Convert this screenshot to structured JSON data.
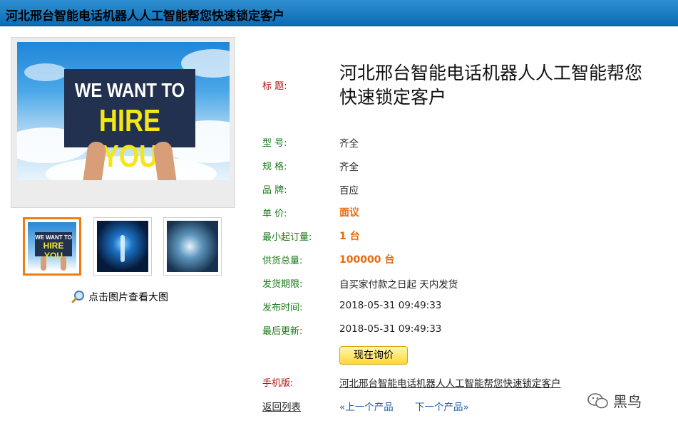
{
  "header": {
    "title": "河北邢台智能电话机器人人工智能帮您快速锁定客户"
  },
  "main_image": {
    "sign_line1": "WE WANT TO",
    "sign_line2": "HIRE YOU"
  },
  "thumbs": [
    {
      "line1": "WE WANT TO",
      "line2": "HIRE YOU"
    }
  ],
  "gallery": {
    "enlarge_label": "点击图片查看大图"
  },
  "details": {
    "title_label": "标  题:",
    "title_value": "河北邢台智能电话机器人人工智能帮您快速锁定客户",
    "model_label": "型  号:",
    "model_value": "齐全",
    "spec_label": "规  格:",
    "spec_value": "齐全",
    "brand_label": "品  牌:",
    "brand_value": "百应",
    "price_label": "单  价:",
    "price_value": "面议",
    "min_order_label": "最小起订量:",
    "min_order_value": "1 台",
    "supply_label": "供货总量:",
    "supply_value": "100000 台",
    "delivery_label": "发货期限:",
    "delivery_value": "自买家付款之日起  天内发货",
    "publish_label": "发布时间:",
    "publish_value": "2018-05-31 09:49:33",
    "update_label": "最后更新:",
    "update_value": "2018-05-31 09:49:33",
    "inquiry_button": "现在询价",
    "mobile_label": "手机版:",
    "mobile_link": "河北邢台智能电话机器人人工智能帮您快速锁定客户"
  },
  "footer": {
    "back_link": "返回列表",
    "prev_link": "«上一个产品",
    "next_link": "下一个产品»"
  },
  "watermark": {
    "text": "黑鸟"
  },
  "colors": {
    "topbar": "#0b6cb6",
    "label_green": "#1a7a1a",
    "label_red": "#b31313",
    "accent_orange": "#e86a0d"
  }
}
